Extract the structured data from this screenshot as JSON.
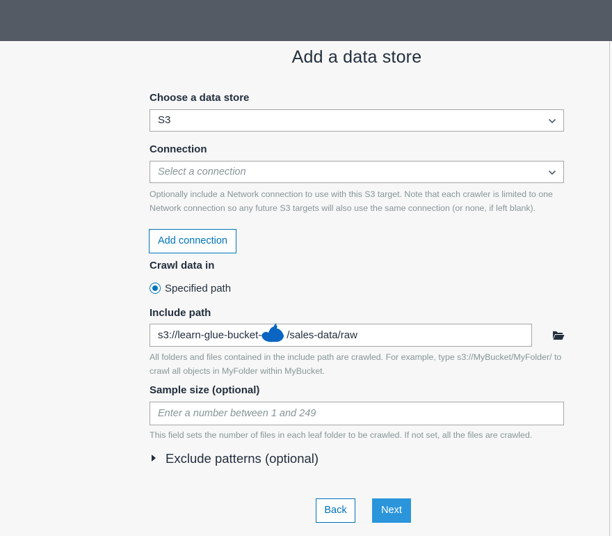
{
  "page": {
    "title": "Add a data store"
  },
  "data_store": {
    "label": "Choose a data store",
    "selected": "S3"
  },
  "connection": {
    "label": "Connection",
    "placeholder": "Select a connection",
    "help": "Optionally include a Network connection to use with this S3 target. Note that each crawler is limited to one Network connection so any future S3 targets will also use the same connection (or none, if left blank).",
    "add_button": "Add connection"
  },
  "crawl": {
    "label": "Crawl data in",
    "option": "Specified path"
  },
  "include_path": {
    "label": "Include path",
    "value": "s3://learn-glue-bucket-",
    "value_suffix": "/sales-data/raw",
    "help": "All folders and files contained in the include path are crawled. For example, type s3://MyBucket/MyFolder/ to crawl all objects in MyFolder within MyBucket.",
    "browse_icon": "folder-open-icon"
  },
  "sample_size": {
    "label": "Sample size (optional)",
    "placeholder": "Enter a number between 1 and 249",
    "help": "This field sets the number of files in each leaf folder to be crawled. If not set, all the files are crawled."
  },
  "exclude": {
    "label": "Exclude patterns (optional)"
  },
  "footer": {
    "back": "Back",
    "next": "Next"
  },
  "colors": {
    "topbar": "#545b64",
    "accent": "#0073bb",
    "primary_button": "#2b95dc",
    "redaction": "#0a66c2"
  }
}
